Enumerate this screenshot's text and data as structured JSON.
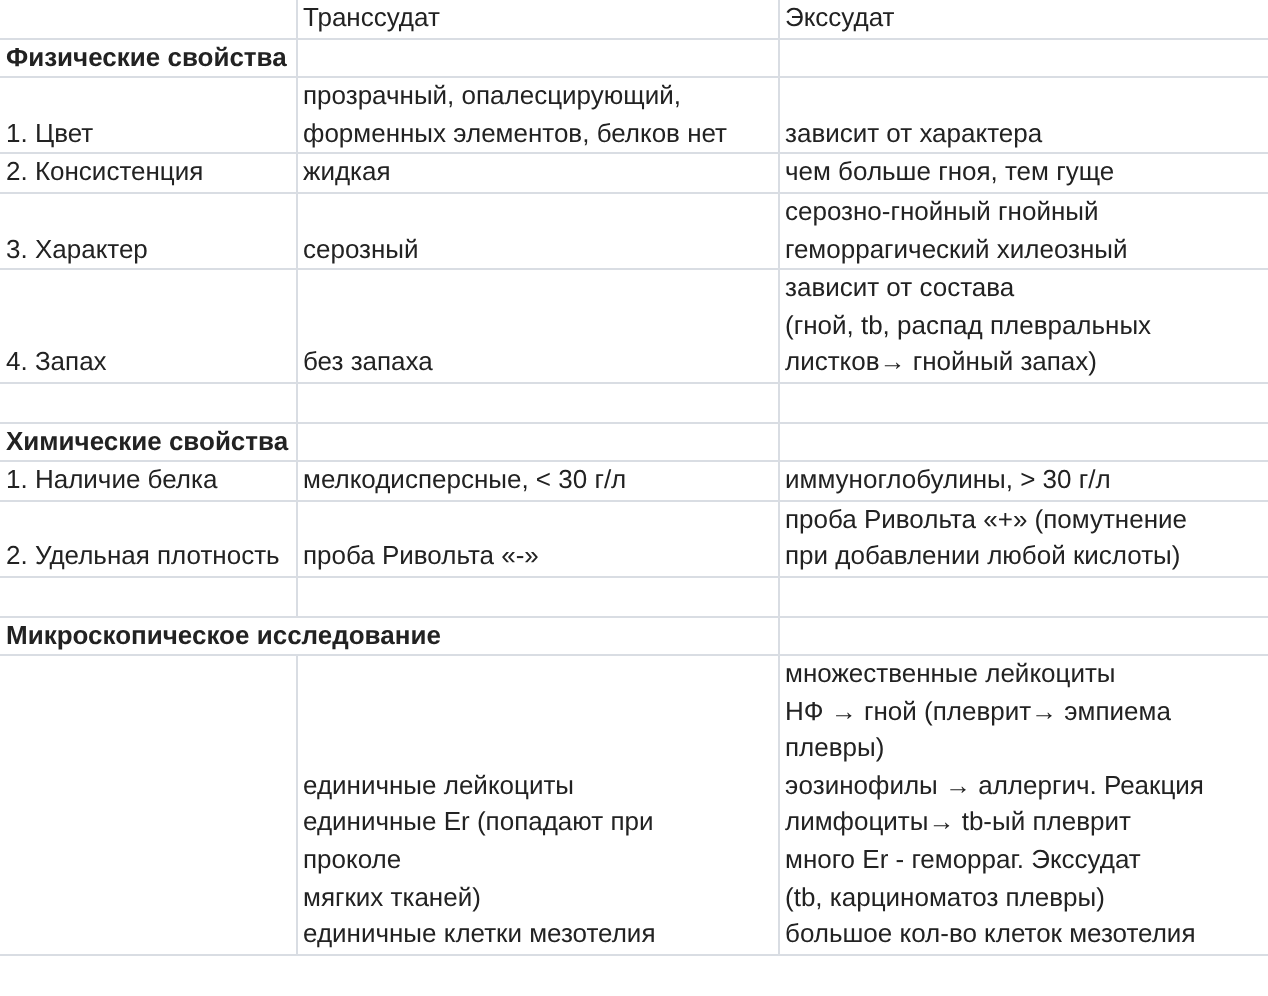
{
  "table": {
    "columns": [
      null,
      "Транссудат",
      "Экссудат"
    ],
    "rows": [
      {
        "kind": "section",
        "label": "Физические свойства",
        "merged": false
      },
      {
        "kind": "data",
        "cells": [
          "1. Цвет",
          "прозрачный, опалесцирующий,\nформенных элементов, белков нет",
          "зависит от характера"
        ]
      },
      {
        "kind": "data",
        "cells": [
          "2. Консистенция",
          "жидкая",
          "чем больше гноя, тем гуще"
        ]
      },
      {
        "kind": "data",
        "cells": [
          "3. Характер",
          "серозный",
          "серозно-гнойный гнойный\nгеморрагический хилеозный"
        ]
      },
      {
        "kind": "data",
        "cells": [
          "4. Запах",
          "без запаха",
          "зависит от состава\n(гной, tb, распад плевральных\nлистков→ гнойный запах)"
        ]
      },
      {
        "kind": "blank"
      },
      {
        "kind": "section",
        "label": "Химические свойства",
        "merged": false
      },
      {
        "kind": "data",
        "cells": [
          "1. Наличие белка",
          "мелкодисперсные, < 30 г/л",
          "иммуноглобулины, > 30 г/л"
        ]
      },
      {
        "kind": "data",
        "cells": [
          "2. Удельная плотность",
          "проба Ривольта «-»",
          "проба Ривольта «+» (помутнение\nпри добавлении любой кислоты)"
        ]
      },
      {
        "kind": "blank"
      },
      {
        "kind": "section",
        "label": "Микроскопическое исследование",
        "merged": true
      },
      {
        "kind": "data",
        "cells": [
          null,
          "единичные лейкоциты\nединичные Er (попадают при\nпроколе\nмягких тканей)\nединичные клетки мезотелия",
          "множественные лейкоциты\nНФ → гной (плеврит→ эмпиема\nплевры)\nэозинофилы → аллергич. Реакция\nлимфоциты→ tb-ый плеврит\nмного Er - геморраг. Экссудат\n(tb, карциноматоз плевры)\nбольшое кол-во клеток мезотелия"
        ]
      }
    ]
  }
}
